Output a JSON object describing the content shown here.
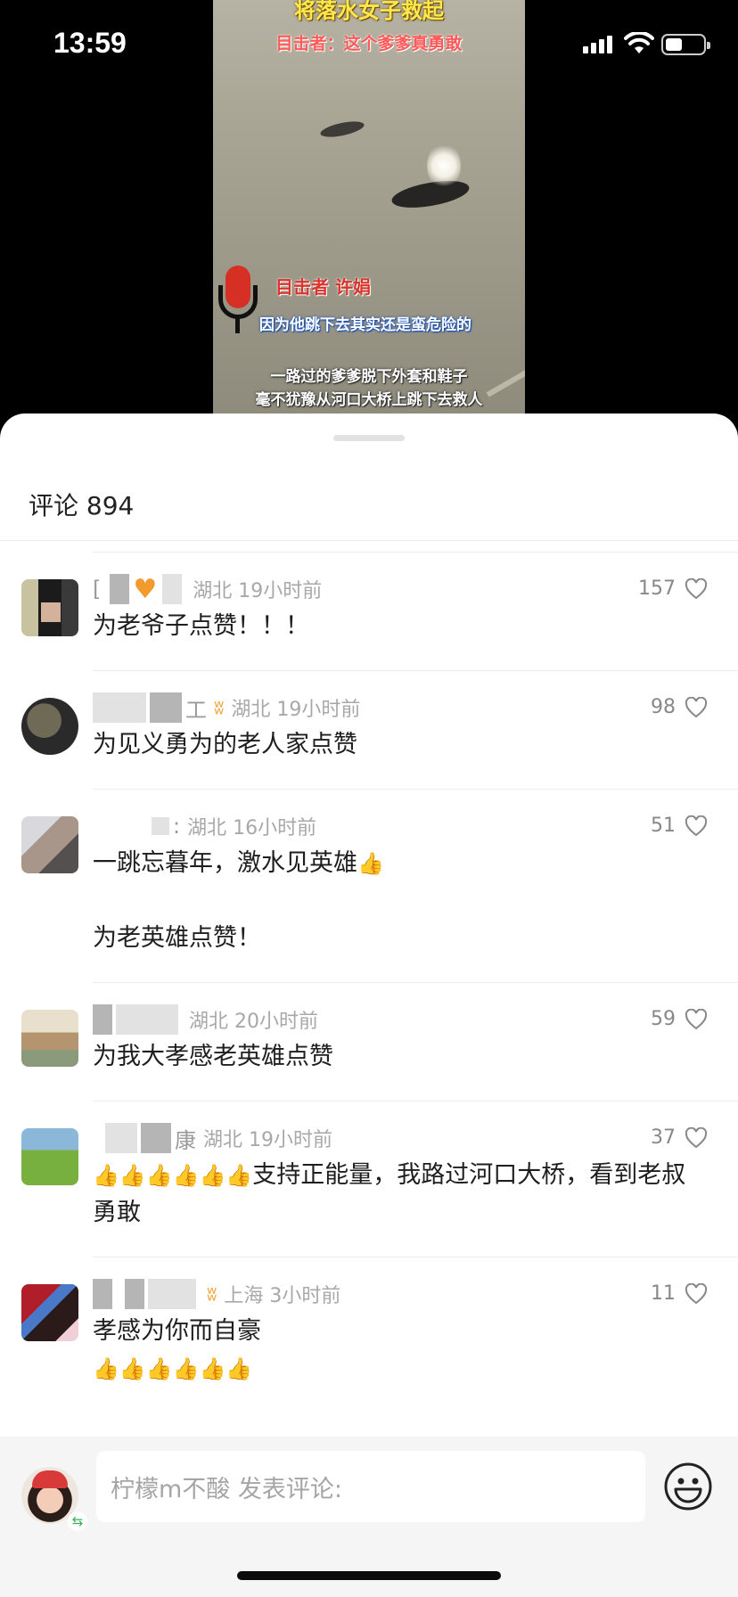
{
  "status_bar": {
    "time": "13:59"
  },
  "video": {
    "title": "将落水女子救起",
    "subtitle": "目击者：这个爹爹真勇敢",
    "speaker": "目击者 许娟",
    "quote": "因为他跳下去其实还是蛮危险的",
    "caption_line1": "一路过的爹爹脱下外套和鞋子",
    "caption_line2": "毫不犹豫从河口大桥上跳下去救人"
  },
  "comments_header": {
    "label": "评论 894"
  },
  "comments": [
    {
      "user": "[",
      "location": "湖北 19小时前",
      "likes": "157",
      "text": "为老爷子点赞！！！"
    },
    {
      "user": "工",
      "location": "湖北 19小时前",
      "likes": "98",
      "text": "为见义勇为的老人家点赞"
    },
    {
      "user": ":",
      "location": "湖北 16小时前",
      "likes": "51",
      "text_line1": "一跳忘暮年，激水见英雄",
      "text_line2": "为老英雄点赞！"
    },
    {
      "user": "",
      "location": "湖北 20小时前",
      "likes": "59",
      "text": "为我大孝感老英雄点赞"
    },
    {
      "user": "康",
      "location": "湖北 19小时前",
      "likes": "37",
      "text": "支持正能量，我路过河口大桥，看到老叔勇敢"
    },
    {
      "user": "",
      "location": "上海 3小时前",
      "likes": "11",
      "text": "孝感为你而自豪"
    }
  ],
  "input": {
    "placeholder": "柠檬m不酸 发表评论:"
  },
  "icons": {
    "like": "heart-outline-icon",
    "emoji": "smiley-icon",
    "thumbs": "thumbs-up-emoji",
    "mic": "microphone-icon"
  },
  "colors": {
    "accent_badge": "#f2a33a",
    "placeholder": "#a5a5a5",
    "sheet_bg": "#ffffff"
  }
}
